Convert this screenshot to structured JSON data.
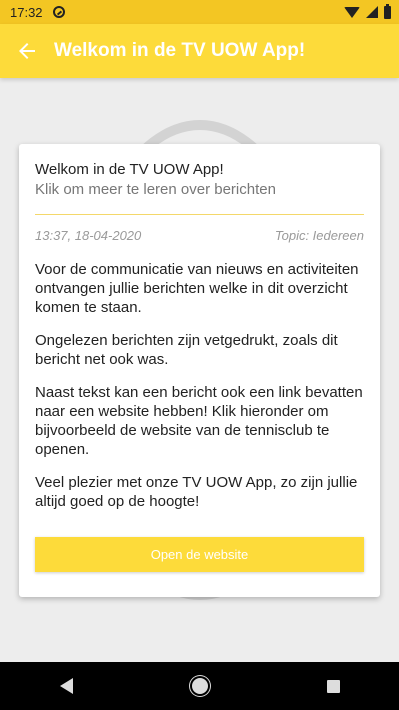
{
  "status_bar": {
    "time": "17:32"
  },
  "app_bar": {
    "title": "Welkom in de TV UOW App!"
  },
  "message": {
    "title": "Welkom in de TV UOW App!",
    "subtitle": "Klik om meer te leren over berichten",
    "timestamp": "13:37, 18-04-2020",
    "topic": "Topic: Iedereen",
    "paragraphs": [
      "Voor de communicatie van nieuws en activiteiten ontvangen jullie berichten welke in dit overzicht komen te staan.",
      "Ongelezen berichten zijn vetgedrukt, zoals dit bericht net ook was.",
      "Naast tekst kan een bericht ook een link bevatten naar een website hebben! Klik hieronder om bijvoorbeeld de website van de tennisclub te openen.",
      "Veel plezier met onze TV UOW App, zo zijn jullie altijd goed op de hoogte!"
    ],
    "button_label": "Open de website"
  },
  "colors": {
    "primary": "#fddb3a",
    "status": "#f3c623"
  },
  "icons": [
    "notification-icon",
    "wifi-icon",
    "signal-icon",
    "battery-icon",
    "back-arrow-icon",
    "nav-back-icon",
    "nav-home-icon",
    "nav-recent-icon"
  ]
}
